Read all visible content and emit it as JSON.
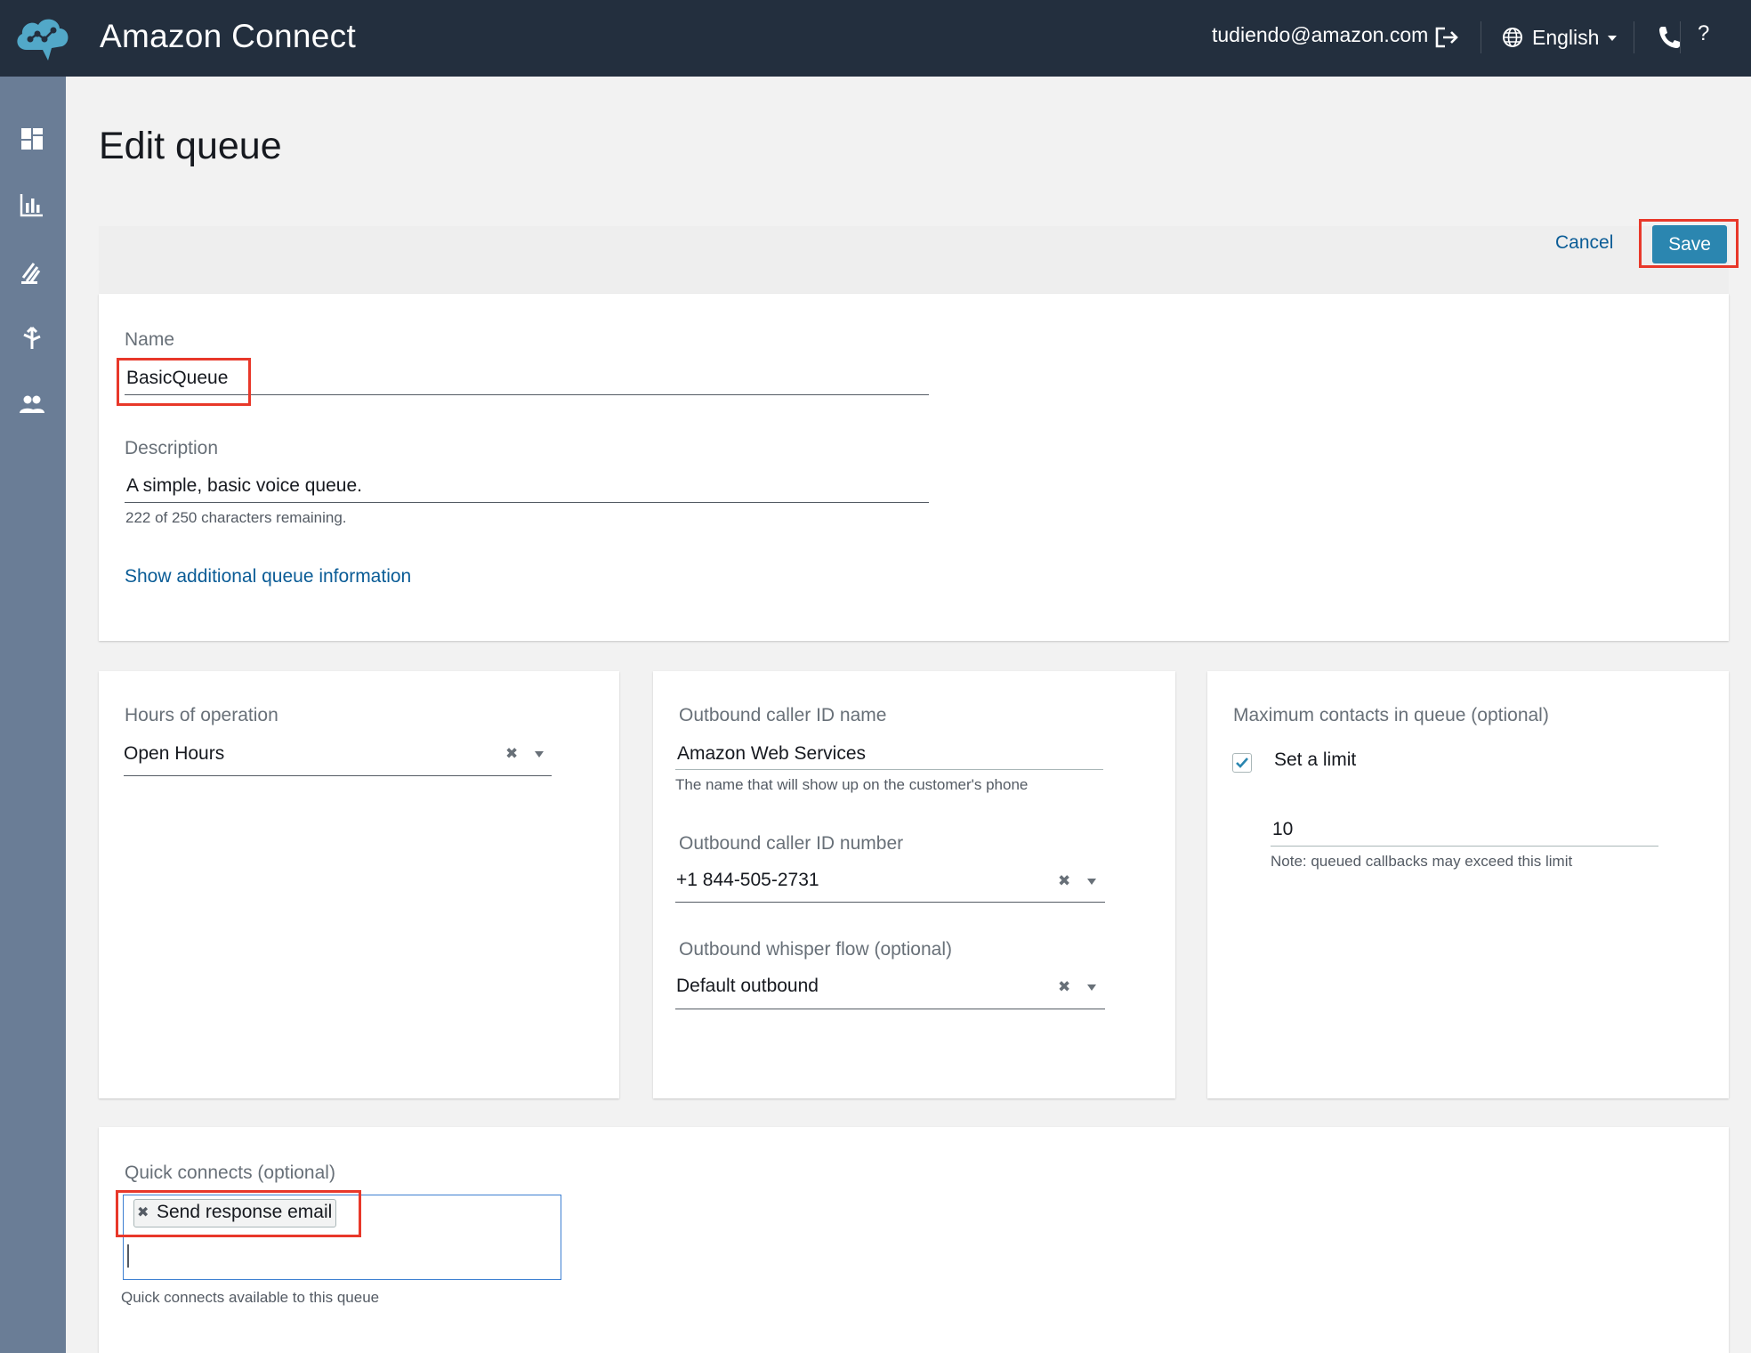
{
  "header": {
    "app_title": "Amazon Connect",
    "user_email": "tudiendo@amazon.com",
    "language": "English",
    "help": "?"
  },
  "sidenav": {
    "items": [
      "dashboard-icon",
      "metrics-icon",
      "routing-icon",
      "flows-icon",
      "users-icon"
    ]
  },
  "page": {
    "title": "Edit queue",
    "cancel_label": "Cancel",
    "save_label": "Save"
  },
  "general": {
    "name_label": "Name",
    "name_value": "BasicQueue",
    "description_label": "Description",
    "description_value": "A simple, basic voice queue.",
    "description_hint": "222 of 250 characters remaining.",
    "show_more_link": "Show additional queue information"
  },
  "hours": {
    "label": "Hours of operation",
    "value": "Open Hours"
  },
  "outbound": {
    "caller_name_label": "Outbound caller ID name",
    "caller_name_value": "Amazon Web Services",
    "caller_name_hint": "The name that will show up on the customer's phone",
    "caller_number_label": "Outbound caller ID number",
    "caller_number_value": "+1 844-505-2731",
    "whisper_label": "Outbound whisper flow (optional)",
    "whisper_value": "Default outbound"
  },
  "max_contacts": {
    "label": "Maximum contacts in queue (optional)",
    "checkbox_label": "Set a limit",
    "checked": true,
    "limit_value": "10",
    "note": "Note: queued callbacks may exceed this limit"
  },
  "quick_connects": {
    "label": "Quick connects (optional)",
    "chips": [
      "Send response email"
    ],
    "hint": "Quick connects available to this queue"
  },
  "colors": {
    "topbar": "#232f3e",
    "sidenav": "#6a7d96",
    "primary_button": "#2b86b0",
    "link": "#0a5c96",
    "highlight": "#e8382a"
  }
}
